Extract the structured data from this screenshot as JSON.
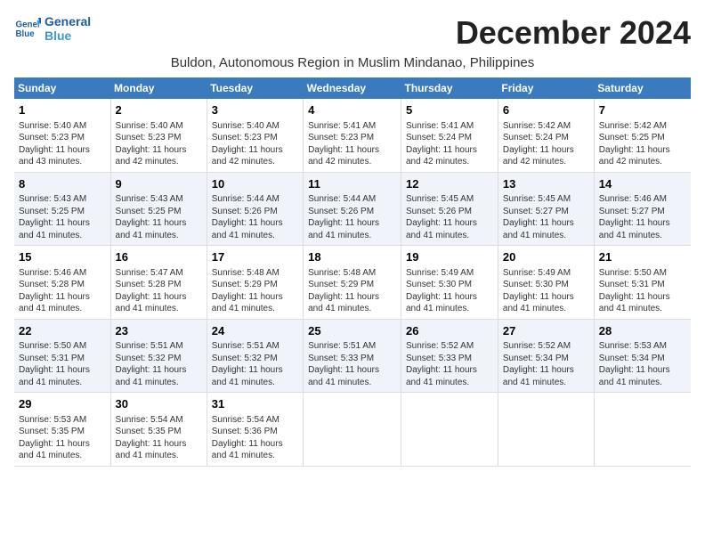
{
  "logo": {
    "line1": "General",
    "line2": "Blue"
  },
  "title": "December 2024",
  "location": "Buldon, Autonomous Region in Muslim Mindanao, Philippines",
  "days_of_week": [
    "Sunday",
    "Monday",
    "Tuesday",
    "Wednesday",
    "Thursday",
    "Friday",
    "Saturday"
  ],
  "weeks": [
    [
      {
        "num": "1",
        "info": "Sunrise: 5:40 AM\nSunset: 5:23 PM\nDaylight: 11 hours\nand 43 minutes."
      },
      {
        "num": "2",
        "info": "Sunrise: 5:40 AM\nSunset: 5:23 PM\nDaylight: 11 hours\nand 42 minutes."
      },
      {
        "num": "3",
        "info": "Sunrise: 5:40 AM\nSunset: 5:23 PM\nDaylight: 11 hours\nand 42 minutes."
      },
      {
        "num": "4",
        "info": "Sunrise: 5:41 AM\nSunset: 5:23 PM\nDaylight: 11 hours\nand 42 minutes."
      },
      {
        "num": "5",
        "info": "Sunrise: 5:41 AM\nSunset: 5:24 PM\nDaylight: 11 hours\nand 42 minutes."
      },
      {
        "num": "6",
        "info": "Sunrise: 5:42 AM\nSunset: 5:24 PM\nDaylight: 11 hours\nand 42 minutes."
      },
      {
        "num": "7",
        "info": "Sunrise: 5:42 AM\nSunset: 5:25 PM\nDaylight: 11 hours\nand 42 minutes."
      }
    ],
    [
      {
        "num": "8",
        "info": "Sunrise: 5:43 AM\nSunset: 5:25 PM\nDaylight: 11 hours\nand 41 minutes."
      },
      {
        "num": "9",
        "info": "Sunrise: 5:43 AM\nSunset: 5:25 PM\nDaylight: 11 hours\nand 41 minutes."
      },
      {
        "num": "10",
        "info": "Sunrise: 5:44 AM\nSunset: 5:26 PM\nDaylight: 11 hours\nand 41 minutes."
      },
      {
        "num": "11",
        "info": "Sunrise: 5:44 AM\nSunset: 5:26 PM\nDaylight: 11 hours\nand 41 minutes."
      },
      {
        "num": "12",
        "info": "Sunrise: 5:45 AM\nSunset: 5:26 PM\nDaylight: 11 hours\nand 41 minutes."
      },
      {
        "num": "13",
        "info": "Sunrise: 5:45 AM\nSunset: 5:27 PM\nDaylight: 11 hours\nand 41 minutes."
      },
      {
        "num": "14",
        "info": "Sunrise: 5:46 AM\nSunset: 5:27 PM\nDaylight: 11 hours\nand 41 minutes."
      }
    ],
    [
      {
        "num": "15",
        "info": "Sunrise: 5:46 AM\nSunset: 5:28 PM\nDaylight: 11 hours\nand 41 minutes."
      },
      {
        "num": "16",
        "info": "Sunrise: 5:47 AM\nSunset: 5:28 PM\nDaylight: 11 hours\nand 41 minutes."
      },
      {
        "num": "17",
        "info": "Sunrise: 5:48 AM\nSunset: 5:29 PM\nDaylight: 11 hours\nand 41 minutes."
      },
      {
        "num": "18",
        "info": "Sunrise: 5:48 AM\nSunset: 5:29 PM\nDaylight: 11 hours\nand 41 minutes."
      },
      {
        "num": "19",
        "info": "Sunrise: 5:49 AM\nSunset: 5:30 PM\nDaylight: 11 hours\nand 41 minutes."
      },
      {
        "num": "20",
        "info": "Sunrise: 5:49 AM\nSunset: 5:30 PM\nDaylight: 11 hours\nand 41 minutes."
      },
      {
        "num": "21",
        "info": "Sunrise: 5:50 AM\nSunset: 5:31 PM\nDaylight: 11 hours\nand 41 minutes."
      }
    ],
    [
      {
        "num": "22",
        "info": "Sunrise: 5:50 AM\nSunset: 5:31 PM\nDaylight: 11 hours\nand 41 minutes."
      },
      {
        "num": "23",
        "info": "Sunrise: 5:51 AM\nSunset: 5:32 PM\nDaylight: 11 hours\nand 41 minutes."
      },
      {
        "num": "24",
        "info": "Sunrise: 5:51 AM\nSunset: 5:32 PM\nDaylight: 11 hours\nand 41 minutes."
      },
      {
        "num": "25",
        "info": "Sunrise: 5:51 AM\nSunset: 5:33 PM\nDaylight: 11 hours\nand 41 minutes."
      },
      {
        "num": "26",
        "info": "Sunrise: 5:52 AM\nSunset: 5:33 PM\nDaylight: 11 hours\nand 41 minutes."
      },
      {
        "num": "27",
        "info": "Sunrise: 5:52 AM\nSunset: 5:34 PM\nDaylight: 11 hours\nand 41 minutes."
      },
      {
        "num": "28",
        "info": "Sunrise: 5:53 AM\nSunset: 5:34 PM\nDaylight: 11 hours\nand 41 minutes."
      }
    ],
    [
      {
        "num": "29",
        "info": "Sunrise: 5:53 AM\nSunset: 5:35 PM\nDaylight: 11 hours\nand 41 minutes."
      },
      {
        "num": "30",
        "info": "Sunrise: 5:54 AM\nSunset: 5:35 PM\nDaylight: 11 hours\nand 41 minutes."
      },
      {
        "num": "31",
        "info": "Sunrise: 5:54 AM\nSunset: 5:36 PM\nDaylight: 11 hours\nand 41 minutes."
      },
      {
        "num": "",
        "info": ""
      },
      {
        "num": "",
        "info": ""
      },
      {
        "num": "",
        "info": ""
      },
      {
        "num": "",
        "info": ""
      }
    ]
  ]
}
